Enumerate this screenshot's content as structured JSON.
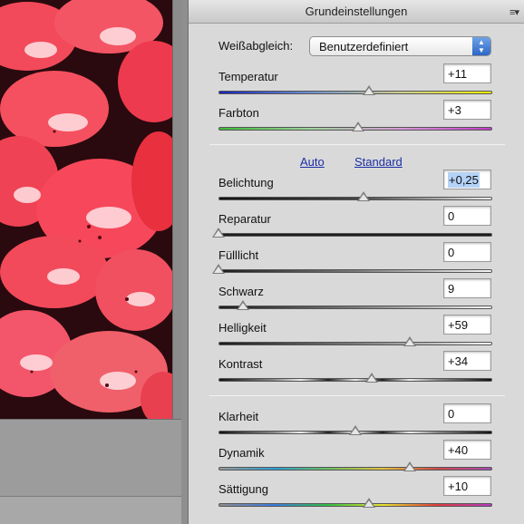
{
  "panel": {
    "title": "Grundeinstellungen",
    "menu_icon": "panel-menu-icon"
  },
  "white_balance": {
    "label": "Weißabgleich:",
    "value": "Benutzerdefiniert"
  },
  "links": {
    "auto": "Auto",
    "standard": "Standard"
  },
  "controls": [
    {
      "label": "Temperatur",
      "value": "+11",
      "level": 0.55
    },
    {
      "label": "Farbton",
      "value": "+3",
      "level": 0.51
    },
    {
      "label": "Belichtung",
      "value": "+0,25",
      "level": 0.53
    },
    {
      "label": "Reparatur",
      "value": "0",
      "level": 0.0
    },
    {
      "label": "Fülllicht",
      "value": "0",
      "level": 0.0
    },
    {
      "label": "Schwarz",
      "value": "9",
      "level": 0.09
    },
    {
      "label": "Helligkeit",
      "value": "+59",
      "level": 0.7
    },
    {
      "label": "Kontrast",
      "value": "+34",
      "level": 0.56
    },
    {
      "label": "Klarheit",
      "value": "0",
      "level": 0.5
    },
    {
      "label": "Dynamik",
      "value": "+40",
      "level": 0.7
    },
    {
      "label": "Sättigung",
      "value": "+10",
      "level": 0.55
    }
  ]
}
